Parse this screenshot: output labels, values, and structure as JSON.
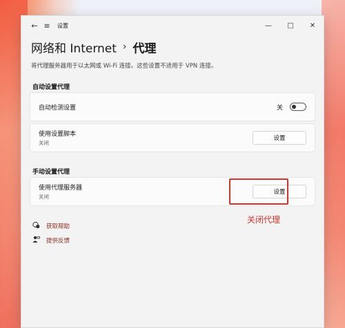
{
  "titlebar": {
    "back_icon": "←",
    "menu_icon": "≡",
    "app_title": "设置",
    "minimize_icon": "—",
    "maximize_icon": "□",
    "close_icon": "✕"
  },
  "header": {
    "parent": "网络和 Internet",
    "separator": "›",
    "current": "代理"
  },
  "description": "将代理服务器用于以太网或 Wi-Fi 连接。这些设置不适用于 VPN 连接。",
  "auto_section": {
    "label": "自动设置代理",
    "detect": {
      "title": "自动检测设置",
      "state_label": "关"
    },
    "script": {
      "title": "使用设置脚本",
      "subtitle": "关闭",
      "button": "设置"
    }
  },
  "manual_section": {
    "label": "手动设置代理",
    "proxy": {
      "title": "使用代理服务器",
      "subtitle": "关闭",
      "button": "设置"
    }
  },
  "annotation": "关闭代理",
  "links": {
    "help": {
      "icon": "help-icon",
      "label": "获取帮助"
    },
    "feedback": {
      "icon": "feedback-icon",
      "label": "提供反馈"
    }
  },
  "colors": {
    "accent_red": "#d6322a",
    "link": "#8b2e22"
  }
}
